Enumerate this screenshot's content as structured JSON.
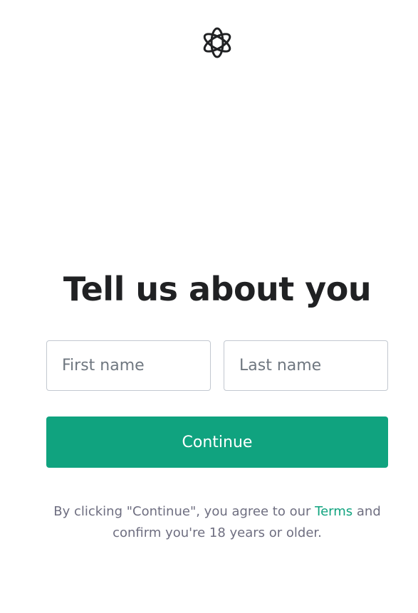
{
  "brand": {
    "logo_icon": "openai-logo-icon"
  },
  "heading": {
    "title": "Tell us about you"
  },
  "form": {
    "first_name_placeholder": "First name",
    "first_name_value": "",
    "last_name_placeholder": "Last name",
    "last_name_value": "",
    "continue_label": "Continue"
  },
  "legal": {
    "prefix": "By clicking \"Continue\", you agree to our ",
    "terms_link": "Terms",
    "suffix": " and confirm you're 18 years or older."
  },
  "colors": {
    "accent": "#10a37f",
    "heading": "#202123",
    "muted_text": "#6e6e80",
    "input_border": "#c2c8d0"
  }
}
